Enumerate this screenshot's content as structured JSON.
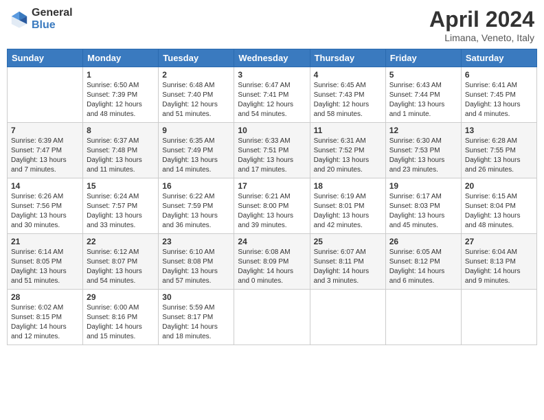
{
  "header": {
    "logo_general": "General",
    "logo_blue": "Blue",
    "title": "April 2024",
    "subtitle": "Limana, Veneto, Italy"
  },
  "days_of_week": [
    "Sunday",
    "Monday",
    "Tuesday",
    "Wednesday",
    "Thursday",
    "Friday",
    "Saturday"
  ],
  "weeks": [
    [
      {
        "day": "",
        "sunrise": "",
        "sunset": "",
        "daylight": ""
      },
      {
        "day": "1",
        "sunrise": "Sunrise: 6:50 AM",
        "sunset": "Sunset: 7:39 PM",
        "daylight": "Daylight: 12 hours and 48 minutes."
      },
      {
        "day": "2",
        "sunrise": "Sunrise: 6:48 AM",
        "sunset": "Sunset: 7:40 PM",
        "daylight": "Daylight: 12 hours and 51 minutes."
      },
      {
        "day": "3",
        "sunrise": "Sunrise: 6:47 AM",
        "sunset": "Sunset: 7:41 PM",
        "daylight": "Daylight: 12 hours and 54 minutes."
      },
      {
        "day": "4",
        "sunrise": "Sunrise: 6:45 AM",
        "sunset": "Sunset: 7:43 PM",
        "daylight": "Daylight: 12 hours and 58 minutes."
      },
      {
        "day": "5",
        "sunrise": "Sunrise: 6:43 AM",
        "sunset": "Sunset: 7:44 PM",
        "daylight": "Daylight: 13 hours and 1 minute."
      },
      {
        "day": "6",
        "sunrise": "Sunrise: 6:41 AM",
        "sunset": "Sunset: 7:45 PM",
        "daylight": "Daylight: 13 hours and 4 minutes."
      }
    ],
    [
      {
        "day": "7",
        "sunrise": "Sunrise: 6:39 AM",
        "sunset": "Sunset: 7:47 PM",
        "daylight": "Daylight: 13 hours and 7 minutes."
      },
      {
        "day": "8",
        "sunrise": "Sunrise: 6:37 AM",
        "sunset": "Sunset: 7:48 PM",
        "daylight": "Daylight: 13 hours and 11 minutes."
      },
      {
        "day": "9",
        "sunrise": "Sunrise: 6:35 AM",
        "sunset": "Sunset: 7:49 PM",
        "daylight": "Daylight: 13 hours and 14 minutes."
      },
      {
        "day": "10",
        "sunrise": "Sunrise: 6:33 AM",
        "sunset": "Sunset: 7:51 PM",
        "daylight": "Daylight: 13 hours and 17 minutes."
      },
      {
        "day": "11",
        "sunrise": "Sunrise: 6:31 AM",
        "sunset": "Sunset: 7:52 PM",
        "daylight": "Daylight: 13 hours and 20 minutes."
      },
      {
        "day": "12",
        "sunrise": "Sunrise: 6:30 AM",
        "sunset": "Sunset: 7:53 PM",
        "daylight": "Daylight: 13 hours and 23 minutes."
      },
      {
        "day": "13",
        "sunrise": "Sunrise: 6:28 AM",
        "sunset": "Sunset: 7:55 PM",
        "daylight": "Daylight: 13 hours and 26 minutes."
      }
    ],
    [
      {
        "day": "14",
        "sunrise": "Sunrise: 6:26 AM",
        "sunset": "Sunset: 7:56 PM",
        "daylight": "Daylight: 13 hours and 30 minutes."
      },
      {
        "day": "15",
        "sunrise": "Sunrise: 6:24 AM",
        "sunset": "Sunset: 7:57 PM",
        "daylight": "Daylight: 13 hours and 33 minutes."
      },
      {
        "day": "16",
        "sunrise": "Sunrise: 6:22 AM",
        "sunset": "Sunset: 7:59 PM",
        "daylight": "Daylight: 13 hours and 36 minutes."
      },
      {
        "day": "17",
        "sunrise": "Sunrise: 6:21 AM",
        "sunset": "Sunset: 8:00 PM",
        "daylight": "Daylight: 13 hours and 39 minutes."
      },
      {
        "day": "18",
        "sunrise": "Sunrise: 6:19 AM",
        "sunset": "Sunset: 8:01 PM",
        "daylight": "Daylight: 13 hours and 42 minutes."
      },
      {
        "day": "19",
        "sunrise": "Sunrise: 6:17 AM",
        "sunset": "Sunset: 8:03 PM",
        "daylight": "Daylight: 13 hours and 45 minutes."
      },
      {
        "day": "20",
        "sunrise": "Sunrise: 6:15 AM",
        "sunset": "Sunset: 8:04 PM",
        "daylight": "Daylight: 13 hours and 48 minutes."
      }
    ],
    [
      {
        "day": "21",
        "sunrise": "Sunrise: 6:14 AM",
        "sunset": "Sunset: 8:05 PM",
        "daylight": "Daylight: 13 hours and 51 minutes."
      },
      {
        "day": "22",
        "sunrise": "Sunrise: 6:12 AM",
        "sunset": "Sunset: 8:07 PM",
        "daylight": "Daylight: 13 hours and 54 minutes."
      },
      {
        "day": "23",
        "sunrise": "Sunrise: 6:10 AM",
        "sunset": "Sunset: 8:08 PM",
        "daylight": "Daylight: 13 hours and 57 minutes."
      },
      {
        "day": "24",
        "sunrise": "Sunrise: 6:08 AM",
        "sunset": "Sunset: 8:09 PM",
        "daylight": "Daylight: 14 hours and 0 minutes."
      },
      {
        "day": "25",
        "sunrise": "Sunrise: 6:07 AM",
        "sunset": "Sunset: 8:11 PM",
        "daylight": "Daylight: 14 hours and 3 minutes."
      },
      {
        "day": "26",
        "sunrise": "Sunrise: 6:05 AM",
        "sunset": "Sunset: 8:12 PM",
        "daylight": "Daylight: 14 hours and 6 minutes."
      },
      {
        "day": "27",
        "sunrise": "Sunrise: 6:04 AM",
        "sunset": "Sunset: 8:13 PM",
        "daylight": "Daylight: 14 hours and 9 minutes."
      }
    ],
    [
      {
        "day": "28",
        "sunrise": "Sunrise: 6:02 AM",
        "sunset": "Sunset: 8:15 PM",
        "daylight": "Daylight: 14 hours and 12 minutes."
      },
      {
        "day": "29",
        "sunrise": "Sunrise: 6:00 AM",
        "sunset": "Sunset: 8:16 PM",
        "daylight": "Daylight: 14 hours and 15 minutes."
      },
      {
        "day": "30",
        "sunrise": "Sunrise: 5:59 AM",
        "sunset": "Sunset: 8:17 PM",
        "daylight": "Daylight: 14 hours and 18 minutes."
      },
      {
        "day": "",
        "sunrise": "",
        "sunset": "",
        "daylight": ""
      },
      {
        "day": "",
        "sunrise": "",
        "sunset": "",
        "daylight": ""
      },
      {
        "day": "",
        "sunrise": "",
        "sunset": "",
        "daylight": ""
      },
      {
        "day": "",
        "sunrise": "",
        "sunset": "",
        "daylight": ""
      }
    ]
  ]
}
